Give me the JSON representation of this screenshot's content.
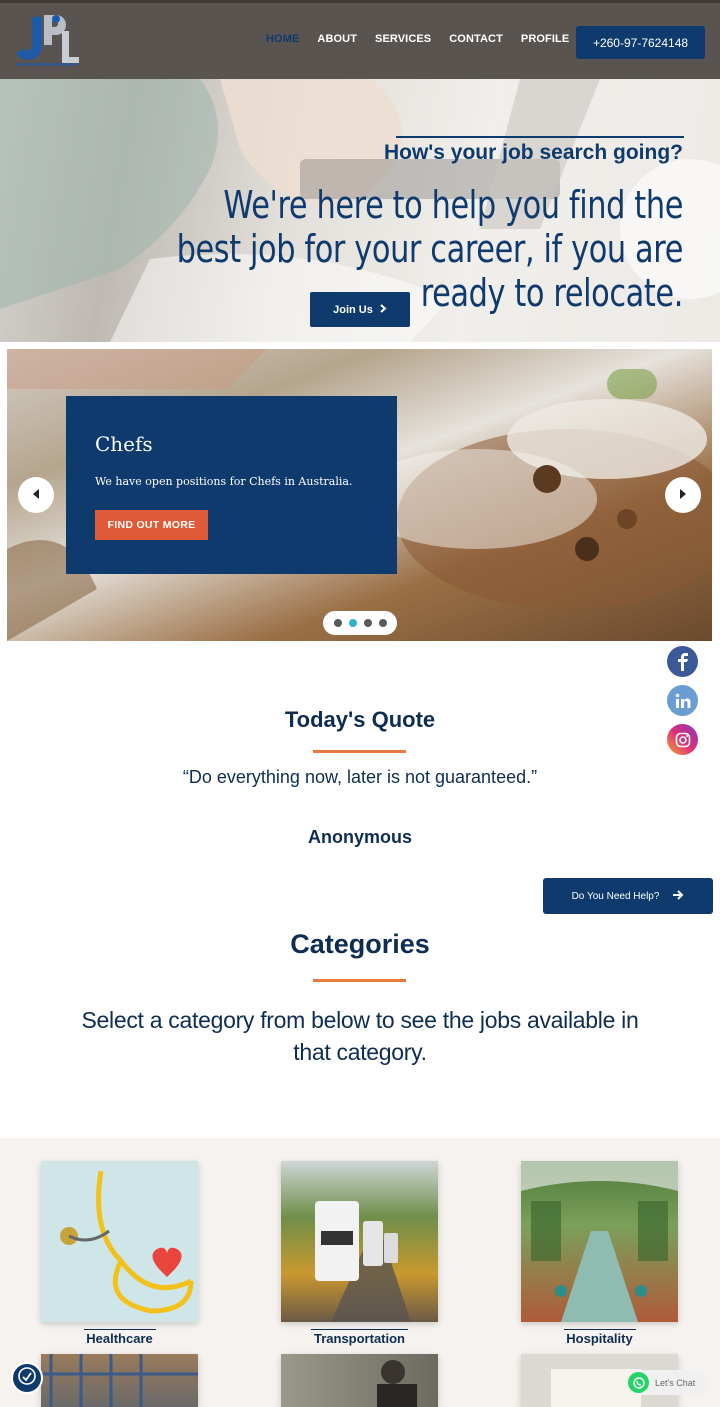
{
  "header": {
    "logo_text": "JPL",
    "nav": [
      "HOME",
      "ABOUT",
      "SERVICES",
      "CONTACT",
      "PROFILE"
    ],
    "active_nav": "HOME",
    "phone": "+260-97-7624148"
  },
  "hero": {
    "subtitle": "How's your job search going?",
    "title": "We're here to help you find the best job for your career, if you are ready to relocate.",
    "join_label": "Join Us"
  },
  "slider": {
    "title": "Chefs",
    "text": "We have open positions for Chefs in Australia.",
    "button": "FIND OUT MORE",
    "slide_count": 4,
    "active_index": 1
  },
  "social": [
    "facebook-icon",
    "linkedin-icon",
    "instagram-icon"
  ],
  "quote": {
    "title": "Today's Quote",
    "text": "“Do everything now, later is not guaranteed.”",
    "author": "Anonymous"
  },
  "help_button": "Do You Need Help?",
  "categories": {
    "title": "Categories",
    "description": "Select a category from below to see the jobs available in that category.",
    "items": [
      {
        "label": "Healthcare"
      },
      {
        "label": "Transportation"
      },
      {
        "label": "Hospitality"
      }
    ]
  },
  "chat": {
    "label": "Let's Chat"
  },
  "colors": {
    "primary": "#0f3a6e",
    "accent": "#e8783d",
    "slide_button": "#e05a37"
  }
}
